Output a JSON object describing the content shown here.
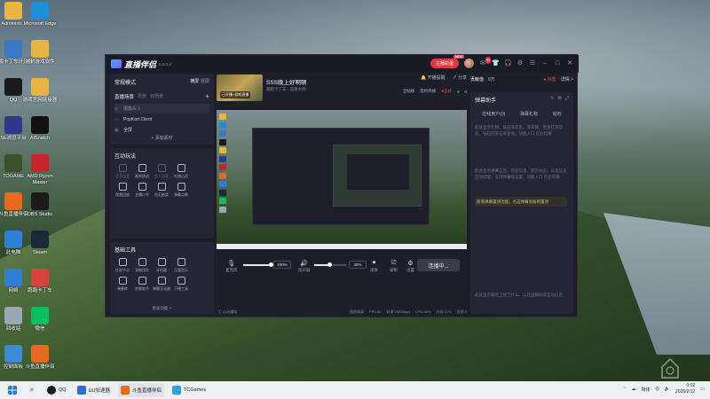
{
  "desktop": {
    "icons": [
      {
        "label": "Administr...",
        "icon": "folder-icon",
        "color": "#e8b640"
      },
      {
        "label": "Microsoft Edge",
        "icon": "edge-icon",
        "color": "#1c8fd8"
      },
      {
        "label": "斯鹏卡丁车计分器",
        "icon": "kart-score-icon",
        "color": "#3a78c7"
      },
      {
        "label": "冰封游戏软件",
        "icon": "folder-icon",
        "color": "#e8b640"
      },
      {
        "label": "QQ",
        "icon": "qq-icon",
        "color": "#1a1a1a"
      },
      {
        "label": "游戏官网链接器",
        "icon": "folder-icon",
        "color": "#e8b640"
      },
      {
        "label": "SE浏览平台",
        "icon": "se-icon",
        "color": "#2d3a8c"
      },
      {
        "label": "AISnatch",
        "icon": "aisnatch-icon",
        "color": "#111111"
      },
      {
        "label": "TOGAME",
        "icon": "togame-icon",
        "color": "#3d4e2a"
      },
      {
        "label": "AMD Ryzen Master",
        "icon": "amd-icon",
        "color": "#c8242b"
      },
      {
        "label": "斗鱼直播伴侣",
        "icon": "douyu-icon",
        "color": "#e86a1e"
      },
      {
        "label": "OBS Studio",
        "icon": "obs-icon",
        "color": "#1b1b1b"
      },
      {
        "label": "此电脑",
        "icon": "this-pc-icon",
        "color": "#2f7fd6"
      },
      {
        "label": "Steam",
        "icon": "steam-icon",
        "color": "#1b2838"
      },
      {
        "label": "网络",
        "icon": "network-icon",
        "color": "#2f7fd6"
      },
      {
        "label": "跑跑卡丁车",
        "icon": "kart-game-icon",
        "color": "#d9433b"
      },
      {
        "label": "回收站",
        "icon": "recycle-bin-icon",
        "color": "#9aa7b4"
      },
      {
        "label": "微信",
        "icon": "wechat-icon",
        "color": "#07c160"
      },
      {
        "label": "控制面板",
        "icon": "control-panel-icon",
        "color": "#3a8ad6"
      },
      {
        "label": "斗鱼直播伴侣",
        "icon": "douyu-icon",
        "color": "#e86a1e"
      }
    ]
  },
  "app": {
    "name": "直播伴侣",
    "version": "5.5.0.4",
    "titlebar": {
      "ad_label": "主播彩蛋",
      "ad_badge": "NEW",
      "mail_badge": "99",
      "icons": [
        "shirt-icon",
        "headset-icon",
        "settings-icon",
        "menu-icon",
        "minimize-icon",
        "maximize-icon",
        "close-icon"
      ]
    },
    "left": {
      "mode_title": "常规模式",
      "mode_switch": "横屏",
      "mode_other": "竖屏",
      "scene_active": "直播场景",
      "scene_tabs": [
        "场景",
        "双场景"
      ],
      "sources": [
        {
          "label": "摄像头 1",
          "selected": true
        },
        {
          "label": "PopKart Client",
          "selected": false
        },
        {
          "label": "全屏",
          "selected": false
        }
      ],
      "add_material": "+ 添加素材",
      "interact_title": "互动玩法",
      "interact_tools": [
        {
          "label": "语音连麦",
          "dim": true
        },
        {
          "label": "嘉宾挑战",
          "dim": false
        },
        {
          "label": "多人连麦",
          "dim": true
        },
        {
          "label": "礼物心愿",
          "dim": false
        },
        {
          "label": "",
          "dim": true
        },
        {
          "label": "视频回放",
          "dim": false
        },
        {
          "label": "主播口令",
          "dim": false
        },
        {
          "label": "钻石抽奖",
          "dim": false
        },
        {
          "label": "弹幕点歌",
          "dim": false
        },
        {
          "label": "",
          "dim": true
        }
      ],
      "base_title": "基础工具",
      "base_tools": [
        {
          "label": "任务中心",
          "dim": false
        },
        {
          "label": "宠物冠名",
          "dim": false
        },
        {
          "label": "计时器",
          "dim": false
        },
        {
          "label": "正版音乐",
          "dim": false
        },
        {
          "label": "",
          "dim": true
        },
        {
          "label": "弹幕库",
          "dim": false
        },
        {
          "label": "房管助手",
          "dim": false
        },
        {
          "label": "弹幕互动器",
          "dim": false
        },
        {
          "label": "下播工具",
          "dim": false
        },
        {
          "label": "",
          "dim": true
        }
      ],
      "more_tools": "更多功能 >"
    },
    "middle": {
      "thumb_tag": "已开播+游戏直播",
      "room_title": "SSS晚上好啊啊",
      "room_sub": "跑跑卡丁车 · 竞速大师",
      "actions": [
        "开播提醒",
        "分享"
      ],
      "stats": [
        "全站榜",
        "签约热榜",
        "0",
        "0"
      ],
      "stats_live": "●正式",
      "mic_label": "麦克风",
      "mic_pct": "200%",
      "speaker_label": "扬声器",
      "speaker_pct": "46%",
      "record_label": "录屏",
      "rec_label": "录制",
      "settings_label": "设置",
      "go_live": "连播中...",
      "status_left": "◎ 心动通知",
      "status_right": [
        "画质高清",
        "FPS:60",
        "码率:2000kbps",
        "CPU:30%",
        "内存:21%",
        "丢帧:0"
      ]
    },
    "right": {
      "tabs": [
        "贡献值",
        "0万"
      ],
      "btn_red": "● 抖音",
      "btn": "详情 >",
      "card_title": "弹幕助手",
      "card_icons": [
        "edit-icon",
        "settings-icon",
        "expand-icon"
      ],
      "sub_tabs": [
        "在线用户(0)",
        "弹幕礼物",
        "钻石"
      ],
      "text1": "此处显示礼物，钻石等信息，等前播，更多打赏信息，钻石打赏记录查询，功能入口 在此切换",
      "text2": "此处显示弹幕信息，欢迎信息，提示动态，以及信息互动提醒，支持弹幕框设置，功能入口 在此切换",
      "highlight": "新增弹幕置顶功能，点击弹幕添加到置顶",
      "text3": "此处显示最近上线了什么，以及直播间的互动信息"
    }
  },
  "taskbar": {
    "items": [
      {
        "label": "",
        "icon": "start-icon"
      },
      {
        "label": "",
        "icon": "search-icon"
      },
      {
        "label": "QQ",
        "icon": "qq-icon"
      },
      {
        "label": "UU加速器",
        "icon": "uu-icon"
      },
      {
        "label": "斗鱼直播伴侣",
        "icon": "douyu-icon"
      },
      {
        "label": "TCGames",
        "icon": "tcgames-icon"
      }
    ],
    "tray": {
      "lang": "简体",
      "time": "0:02",
      "date": "2026/2/12"
    }
  }
}
